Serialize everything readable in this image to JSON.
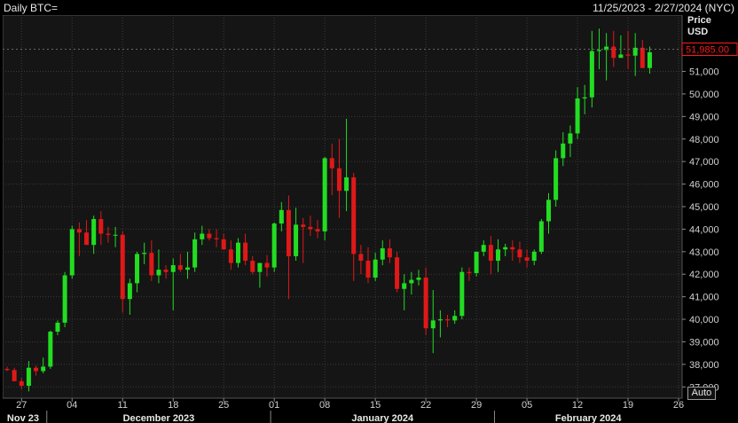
{
  "header": {
    "title": "Daily BTC=",
    "date_range": "11/25/2023 - 2/27/2024 (NYC)"
  },
  "axis": {
    "y_title": "Price",
    "y_unit": "USD",
    "auto_label": "Auto",
    "last_price_label": "51,985.00",
    "ylim": [
      36500,
      53500
    ],
    "yticks": [
      37000,
      38000,
      39000,
      40000,
      41000,
      42000,
      43000,
      44000,
      45000,
      46000,
      47000,
      48000,
      49000,
      50000,
      51000
    ],
    "ytick_labels": [
      "37,000",
      "38,000",
      "39,000",
      "40,000",
      "41,000",
      "42,000",
      "43,000",
      "44,000",
      "45,000",
      "46,000",
      "47,000",
      "48,000",
      "49,000",
      "50,000",
      "51,000"
    ],
    "day_ticks": [
      {
        "date": "2023-11-27",
        "label": "27"
      },
      {
        "date": "2023-12-04",
        "label": "04"
      },
      {
        "date": "2023-12-11",
        "label": "11"
      },
      {
        "date": "2023-12-18",
        "label": "18"
      },
      {
        "date": "2023-12-25",
        "label": "25"
      },
      {
        "date": "2024-01-01",
        "label": "01"
      },
      {
        "date": "2024-01-08",
        "label": "08"
      },
      {
        "date": "2024-01-15",
        "label": "15"
      },
      {
        "date": "2024-01-22",
        "label": "22"
      },
      {
        "date": "2024-01-29",
        "label": "29"
      },
      {
        "date": "2024-02-05",
        "label": "05"
      },
      {
        "date": "2024-02-12",
        "label": "12"
      },
      {
        "date": "2024-02-19",
        "label": "19"
      },
      {
        "date": "2024-02-26",
        "label": "26"
      }
    ],
    "months": [
      {
        "label": "Nov 23",
        "start": "2023-11-25",
        "end": "2023-11-30"
      },
      {
        "label": "December 2023",
        "start": "2023-12-01",
        "end": "2023-12-31"
      },
      {
        "label": "January 2024",
        "start": "2024-01-01",
        "end": "2024-01-31"
      },
      {
        "label": "February 2024",
        "start": "2024-02-01",
        "end": "2024-02-27"
      }
    ]
  },
  "colors": {
    "up": "#22dd22",
    "down": "#e01818",
    "background": "#000000",
    "plot_background": "#151515",
    "grid": "#3a3a3a",
    "price_tag": "#ff1a1a"
  },
  "chart_data": {
    "type": "candlestick",
    "title": "Daily BTC=",
    "xlabel": "",
    "ylabel": "Price USD",
    "grid": true,
    "x_start": "2023-11-25",
    "x_end": "2024-02-27",
    "ylim": [
      36500,
      53500
    ],
    "dates": [
      "2023-11-25",
      "2023-11-26",
      "2023-11-27",
      "2023-11-28",
      "2023-11-29",
      "2023-11-30",
      "2023-12-01",
      "2023-12-02",
      "2023-12-03",
      "2023-12-04",
      "2023-12-05",
      "2023-12-06",
      "2023-12-07",
      "2023-12-08",
      "2023-12-09",
      "2023-12-10",
      "2023-12-11",
      "2023-12-12",
      "2023-12-13",
      "2023-12-14",
      "2023-12-15",
      "2023-12-16",
      "2023-12-17",
      "2023-12-18",
      "2023-12-19",
      "2023-12-20",
      "2023-12-21",
      "2023-12-22",
      "2023-12-23",
      "2023-12-24",
      "2023-12-25",
      "2023-12-26",
      "2023-12-27",
      "2023-12-28",
      "2023-12-29",
      "2023-12-30",
      "2023-12-31",
      "2024-01-01",
      "2024-01-02",
      "2024-01-03",
      "2024-01-04",
      "2024-01-05",
      "2024-01-06",
      "2024-01-07",
      "2024-01-08",
      "2024-01-09",
      "2024-01-10",
      "2024-01-11",
      "2024-01-12",
      "2024-01-13",
      "2024-01-14",
      "2024-01-15",
      "2024-01-16",
      "2024-01-17",
      "2024-01-18",
      "2024-01-19",
      "2024-01-20",
      "2024-01-21",
      "2024-01-22",
      "2024-01-23",
      "2024-01-24",
      "2024-01-25",
      "2024-01-26",
      "2024-01-27",
      "2024-01-28",
      "2024-01-29",
      "2024-01-30",
      "2024-01-31",
      "2024-02-01",
      "2024-02-02",
      "2024-02-03",
      "2024-02-04",
      "2024-02-05",
      "2024-02-06",
      "2024-02-07",
      "2024-02-08",
      "2024-02-09",
      "2024-02-10",
      "2024-02-11",
      "2024-02-12",
      "2024-02-13",
      "2024-02-14",
      "2024-02-15",
      "2024-02-16",
      "2024-02-17",
      "2024-02-18",
      "2024-02-19",
      "2024-02-20",
      "2024-02-21",
      "2024-02-22"
    ],
    "open": [
      37800,
      37750,
      37250,
      37050,
      37850,
      37700,
      37900,
      39450,
      39850,
      41950,
      44000,
      43850,
      43300,
      44450,
      43800,
      43750,
      43750,
      40900,
      41600,
      42900,
      42950,
      41950,
      42200,
      42100,
      42400,
      42200,
      42300,
      43550,
      43800,
      43600,
      43550,
      43100,
      42500,
      43400,
      42600,
      42100,
      42500,
      42300,
      44250,
      44850,
      42800,
      44200,
      44100,
      44000,
      43900,
      47150,
      46700,
      45700,
      46300,
      42900,
      42600,
      41850,
      42650,
      43150,
      42750,
      41350,
      41600,
      41750,
      41850,
      39600,
      39950,
      40000,
      39950,
      40150,
      42100,
      42050,
      43000,
      43300,
      42600,
      43100,
      43200,
      43100,
      42750,
      42600,
      43000,
      44350,
      45300,
      47150,
      47800,
      48250,
      49800,
      49850,
      51900,
      51950,
      52100,
      51600,
      51750,
      51700,
      52050,
      51150
    ],
    "high": [
      37900,
      37850,
      37400,
      38150,
      37950,
      38300,
      39500,
      39950,
      42100,
      44150,
      44300,
      44400,
      44600,
      44800,
      44100,
      44100,
      43900,
      41800,
      43000,
      43400,
      43500,
      43100,
      42400,
      42700,
      42900,
      43000,
      43850,
      44150,
      44000,
      44000,
      43800,
      43500,
      43600,
      43800,
      42800,
      42400,
      42850,
      44300,
      45200,
      45500,
      44950,
      44500,
      44600,
      44400,
      47200,
      47800,
      48000,
      48900,
      46500,
      43300,
      43200,
      42950,
      43500,
      43550,
      43000,
      42000,
      42100,
      42200,
      42300,
      41300,
      40400,
      40200,
      40400,
      42300,
      42300,
      43000,
      43500,
      43700,
      43550,
      43350,
      43500,
      43450,
      43100,
      43100,
      44450,
      45600,
      47500,
      48300,
      48600,
      50300,
      50400,
      52800,
      52900,
      52700,
      52800,
      52600,
      52800,
      52700,
      52400,
      52100
    ],
    "low": [
      37700,
      37500,
      36900,
      36800,
      37500,
      37600,
      37800,
      39300,
      39650,
      41800,
      42800,
      43500,
      42900,
      43300,
      43400,
      43200,
      40300,
      40200,
      41200,
      42450,
      41700,
      41600,
      41800,
      40400,
      42100,
      41800,
      42100,
      43300,
      43500,
      43200,
      43300,
      42200,
      42300,
      42400,
      42000,
      41400,
      41900,
      42100,
      43900,
      40900,
      42600,
      42500,
      43700,
      43600,
      43500,
      45500,
      44500,
      44800,
      41700,
      42000,
      41600,
      41700,
      42400,
      42500,
      41200,
      40400,
      41100,
      41500,
      39300,
      38500,
      39200,
      39650,
      39800,
      40000,
      41700,
      41900,
      42800,
      42000,
      42100,
      42800,
      42600,
      42500,
      42300,
      42400,
      42900,
      43800,
      45000,
      46800,
      47200,
      48000,
      49100,
      49400,
      51100,
      50600,
      51200,
      51700,
      51100,
      50800,
      51700,
      50900
    ],
    "close": [
      37750,
      37250,
      37050,
      37850,
      37700,
      37900,
      39450,
      39850,
      41950,
      44000,
      43850,
      43300,
      44450,
      43800,
      43750,
      43750,
      40900,
      41600,
      42900,
      42950,
      41950,
      42200,
      42100,
      42400,
      42200,
      42300,
      43550,
      43800,
      43600,
      43550,
      43100,
      42500,
      43400,
      42600,
      42100,
      42500,
      42300,
      44250,
      44850,
      42800,
      44200,
      44100,
      44000,
      43900,
      47150,
      46700,
      45700,
      46300,
      42900,
      42600,
      41850,
      42650,
      43150,
      42750,
      41350,
      41600,
      41750,
      41850,
      39600,
      39950,
      40000,
      39950,
      40150,
      42100,
      42050,
      43000,
      43300,
      42600,
      43100,
      43200,
      43100,
      42750,
      42600,
      43000,
      44350,
      45300,
      47150,
      47800,
      48250,
      49800,
      49850,
      51900,
      51950,
      52100,
      51600,
      51750,
      51700,
      52050,
      51150,
      51850
    ],
    "last_price": 51985.0
  }
}
